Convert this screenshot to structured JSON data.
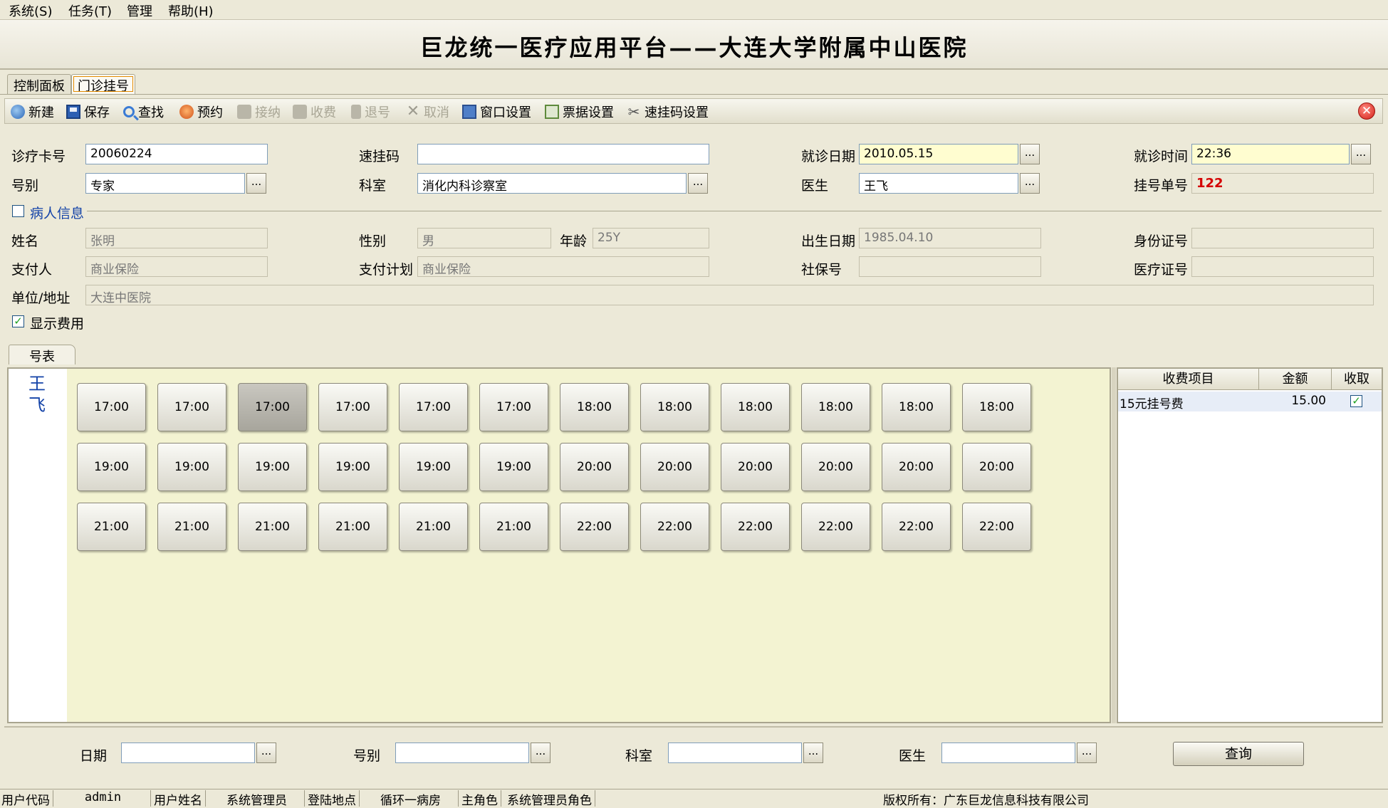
{
  "menu": {
    "system": "系统(S)",
    "task": "任务(T)",
    "manage": "管理",
    "help": "帮助(H)"
  },
  "banner": {
    "title": "巨龙统一医疗应用平台——大连大学附属中山医院"
  },
  "tabs": {
    "dashboard": "控制面板",
    "outpatient": "门诊挂号"
  },
  "toolbar": {
    "new": "新建",
    "save": "保存",
    "find": "查找",
    "reserve": "预约",
    "receive": "接纳",
    "charge": "收费",
    "refund": "退号",
    "cancel": "取消",
    "window_settings": "窗口设置",
    "ticket_settings": "票据设置",
    "quick_code_settings": "速挂码设置"
  },
  "form": {
    "card_no_label": "诊疗卡号",
    "card_no": "20060224",
    "quick_code_label": "速挂码",
    "quick_code": "",
    "visit_date_label": "就诊日期",
    "visit_date": "2010.05.15",
    "visit_time_label": "就诊时间",
    "visit_time": "22:36",
    "type_label": "号别",
    "type": "专家",
    "dept_label": "科室",
    "dept": "消化内科诊察室",
    "doctor_label": "医生",
    "doctor": "王飞",
    "reg_no_label": "挂号单号",
    "reg_no": "122"
  },
  "patient": {
    "section_label": "病人信息",
    "section_checked": false,
    "name_label": "姓名",
    "name": "张明",
    "gender_label": "性别",
    "gender": "男",
    "age_label": "年龄",
    "age": "25Y",
    "birth_label": "出生日期",
    "birth": "1985.04.10",
    "id_label": "身份证号",
    "id": "",
    "payer_label": "支付人",
    "payer": "商业保险",
    "plan_label": "支付计划",
    "plan": "商业保险",
    "social_label": "社保号",
    "social": "",
    "medical_label": "医疗证号",
    "medical": "",
    "address_label": "单位/地址",
    "address": "大连中医院"
  },
  "show_fee": {
    "label": "显示费用",
    "checked": true
  },
  "schedule": {
    "tab": "号表",
    "doctor_chars": [
      "王",
      "飞"
    ],
    "selected_index": 2,
    "slots": [
      "17:00",
      "17:00",
      "17:00",
      "17:00",
      "17:00",
      "17:00",
      "18:00",
      "18:00",
      "18:00",
      "18:00",
      "18:00",
      "18:00",
      "19:00",
      "19:00",
      "19:00",
      "19:00",
      "19:00",
      "19:00",
      "20:00",
      "20:00",
      "20:00",
      "20:00",
      "20:00",
      "20:00",
      "21:00",
      "21:00",
      "21:00",
      "21:00",
      "21:00",
      "21:00",
      "22:00",
      "22:00",
      "22:00",
      "22:00",
      "22:00",
      "22:00"
    ]
  },
  "fees": {
    "headers": {
      "item": "收费项目",
      "amount": "金额",
      "collect": "收取"
    },
    "rows": [
      {
        "item": "15元挂号费",
        "amount": "15.00",
        "collect": true
      }
    ]
  },
  "filter": {
    "date_label": "日期",
    "type_label": "号别",
    "dept_label": "科室",
    "doctor_label": "医生",
    "query": "查询"
  },
  "status": {
    "user_code_label": "用户代码",
    "user_code": "admin",
    "user_name_label": "用户姓名",
    "user_name": "系统管理员",
    "location_label": "登陆地点",
    "location": "循环一病房",
    "role_label": "主角色",
    "role": "系统管理员角色",
    "copyright": "版权所有：广东巨龙信息科技有限公司"
  },
  "colors": {
    "accent_red": "#d40000",
    "doctor_blue": "#1443a8",
    "highlight_yellow": "#fffdd0"
  }
}
